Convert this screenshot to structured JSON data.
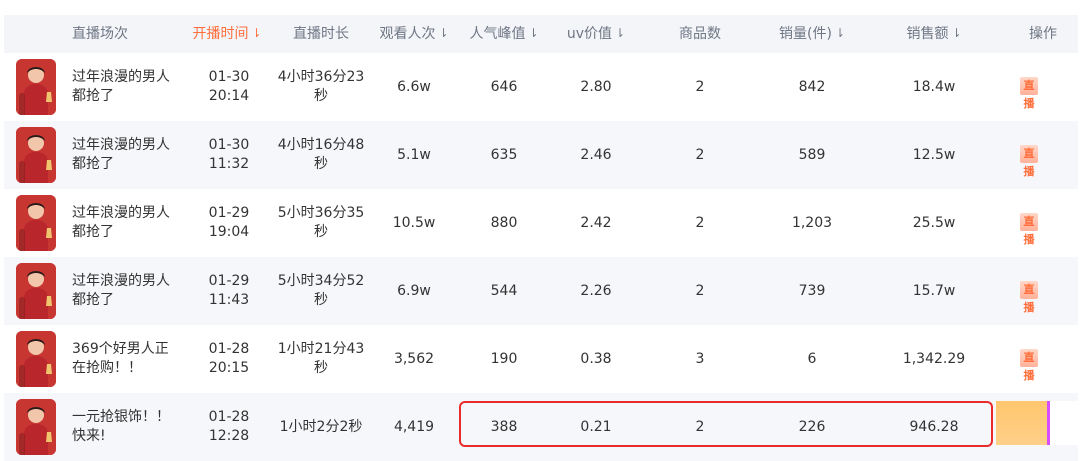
{
  "header": [
    {
      "label": "直播场次",
      "sort": false,
      "active": false
    },
    {
      "label": "开播时间",
      "sort": true,
      "active": true
    },
    {
      "label": "直播时长",
      "sort": false,
      "active": false
    },
    {
      "label": "观看人次",
      "sort": true,
      "active": false
    },
    {
      "label": "人气峰值",
      "sort": true,
      "active": false
    },
    {
      "label": "uv价值",
      "sort": true,
      "active": false
    },
    {
      "label": "商品数",
      "sort": false,
      "active": false
    },
    {
      "label": "销量(件)",
      "sort": true,
      "active": false
    },
    {
      "label": "销售额",
      "sort": true,
      "active": false
    },
    {
      "label": "操作",
      "sort": false,
      "active": false
    }
  ],
  "rows": [
    {
      "title_line1": "过年浪漫的男人",
      "title_line2": "都抢了",
      "date": "01-30",
      "time": "20:14",
      "duration_line1": "4小时36分23",
      "duration_line2": "秒",
      "views": "6.6w",
      "peak": "646",
      "uv": "2.80",
      "products": "2",
      "sales": "842",
      "revenue": "18.4w",
      "action": "直播"
    },
    {
      "title_line1": "过年浪漫的男人",
      "title_line2": "都抢了",
      "date": "01-30",
      "time": "11:32",
      "duration_line1": "4小时16分48",
      "duration_line2": "秒",
      "views": "5.1w",
      "peak": "635",
      "uv": "2.46",
      "products": "2",
      "sales": "589",
      "revenue": "12.5w",
      "action": "直播"
    },
    {
      "title_line1": "过年浪漫的男人",
      "title_line2": "都抢了",
      "date": "01-29",
      "time": "19:04",
      "duration_line1": "5小时36分35",
      "duration_line2": "秒",
      "views": "10.5w",
      "peak": "880",
      "uv": "2.42",
      "products": "2",
      "sales": "1,203",
      "revenue": "25.5w",
      "action": "直播"
    },
    {
      "title_line1": "过年浪漫的男人",
      "title_line2": "都抢了",
      "date": "01-29",
      "time": "11:43",
      "duration_line1": "5小时34分52",
      "duration_line2": "秒",
      "views": "6.9w",
      "peak": "544",
      "uv": "2.26",
      "products": "2",
      "sales": "739",
      "revenue": "15.7w",
      "action": "直播"
    },
    {
      "title_line1": "369个好男人正",
      "title_line2": "在抢购！！",
      "date": "01-28",
      "time": "20:15",
      "duration_line1": "1小时21分43",
      "duration_line2": "秒",
      "views": "3,562",
      "peak": "190",
      "uv": "0.38",
      "products": "3",
      "sales": "6",
      "revenue": "1,342.29",
      "action": "直播"
    },
    {
      "title_line1": "一元抢银饰！！",
      "title_line2": "快来!",
      "date": "01-28",
      "time": "12:28",
      "duration_line1": "1小时2分2秒",
      "duration_line2": "",
      "views": "4,419",
      "peak": "388",
      "uv": "0.21",
      "products": "2",
      "sales": "226",
      "revenue": "946.28",
      "action": ""
    }
  ],
  "colors": {
    "accent": "#ff6e3c",
    "highlight": "#ea2b2b"
  }
}
